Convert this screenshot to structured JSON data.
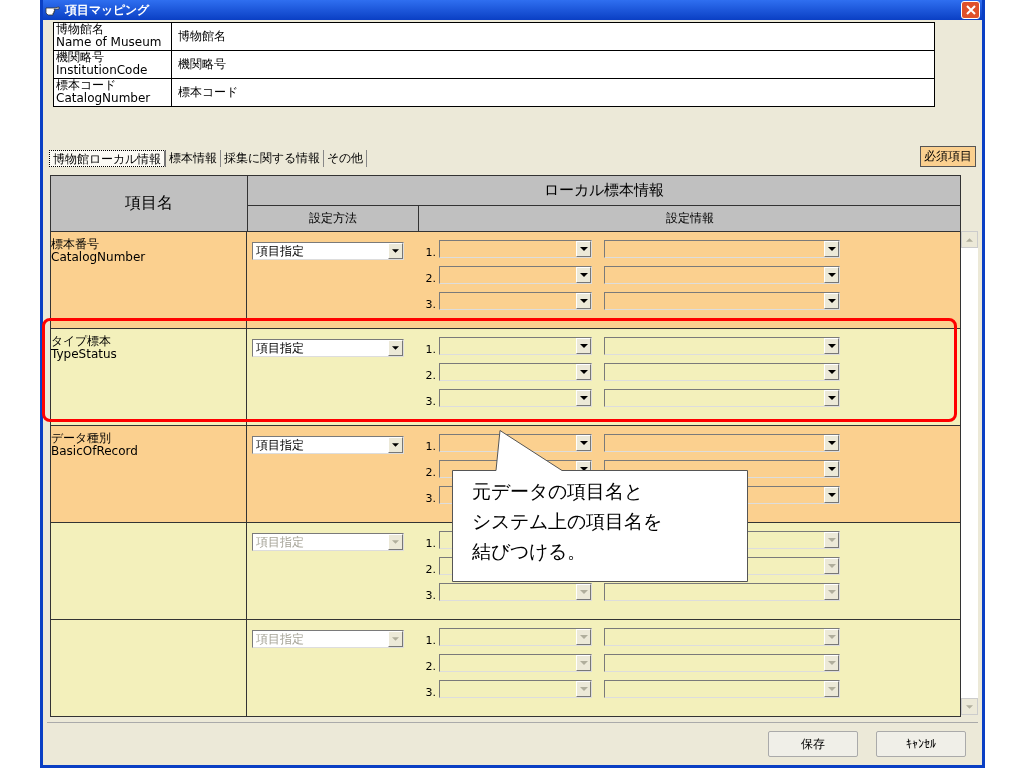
{
  "window": {
    "title": "項目マッピング"
  },
  "header_fields": [
    {
      "label_ja": "博物館名",
      "label_en": "Name of Museum",
      "value": "博物館名"
    },
    {
      "label_ja": "機関略号",
      "label_en": "InstitutionCode",
      "value": "機関略号"
    },
    {
      "label_ja": "標本コード",
      "label_en": "CatalogNumber",
      "value": "標本コード"
    }
  ],
  "tabs": [
    {
      "label": "博物館ローカル情報",
      "selected": true
    },
    {
      "label": "標本情報",
      "selected": false
    },
    {
      "label": "採集に関する情報",
      "selected": false
    },
    {
      "label": "その他",
      "selected": false
    }
  ],
  "required_badge": "必須項目",
  "table": {
    "name_header": "項目名",
    "group_header": "ローカル標本情報",
    "method_header": "設定方法",
    "info_header": "設定情報",
    "rows": [
      {
        "name_ja": "標本番号",
        "name_en": "CatalogNumber",
        "required": true,
        "disabled": false,
        "method": "項目指定",
        "lines": [
          "1.",
          "2.",
          "3."
        ]
      },
      {
        "name_ja": "タイプ標本",
        "name_en": "TypeStatus",
        "required": false,
        "disabled": false,
        "method": "項目指定",
        "lines": [
          "1.",
          "2.",
          "3."
        ]
      },
      {
        "name_ja": "データ種別",
        "name_en": "BasicOfRecord",
        "required": true,
        "disabled": false,
        "method": "項目指定",
        "lines": [
          "1.",
          "2.",
          "3."
        ]
      },
      {
        "required": false,
        "disabled": true,
        "method": "項目指定",
        "lines": [
          "1.",
          "2.",
          "3."
        ]
      },
      {
        "required": false,
        "disabled": true,
        "method": "項目指定",
        "lines": [
          "1.",
          "2.",
          "3."
        ]
      }
    ]
  },
  "annotation": {
    "lines": [
      "元データの項目名と",
      "システム上の項目名を",
      "結びつける。"
    ]
  },
  "buttons": [
    "保存",
    "ｷｬﾝｾﾙ"
  ]
}
